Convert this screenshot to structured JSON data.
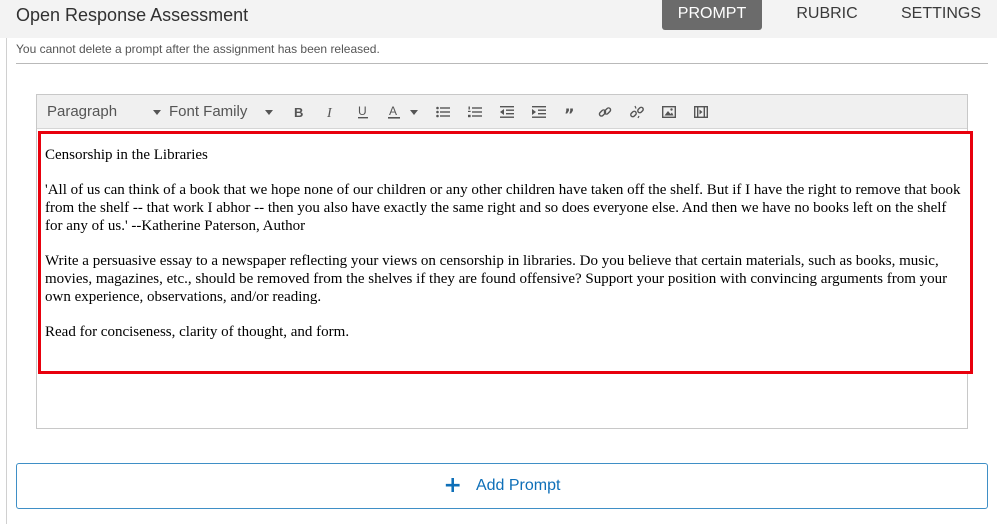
{
  "header": {
    "title": "Open Response Assessment",
    "tabs": [
      {
        "label": "PROMPT",
        "active": true
      },
      {
        "label": "RUBRIC",
        "active": false
      },
      {
        "label": "SETTINGS",
        "active": false
      }
    ]
  },
  "notice": "You cannot delete a prompt after the assignment has been released.",
  "toolbar": {
    "paragraph_label": "Paragraph",
    "font_family_label": "Font Family",
    "icons": [
      "bold-icon",
      "italic-icon",
      "underline-icon",
      "text-color-icon",
      "bullet-list-icon",
      "numbered-list-icon",
      "outdent-icon",
      "indent-icon",
      "blockquote-icon",
      "link-icon",
      "unlink-icon",
      "image-icon",
      "video-icon"
    ]
  },
  "prompt": {
    "title": "Censorship in the Libraries",
    "quote": "'All of us can think of a book that we hope none of our children or any other children have taken off the shelf. But if I have the right to remove that book from the shelf -- that work I abhor -- then you also have exactly the same right and so does everyone else. And then we have no books left on the shelf for any of us.' --Katherine Paterson, Author",
    "instructions": "Write a persuasive essay to a newspaper reflecting your views on censorship in libraries. Do you believe that certain materials, such as books, music, movies, magazines, etc., should be removed from the shelves if they are found offensive? Support your position with convincing arguments from your own experience, observations, and/or reading.",
    "criteria": "Read for conciseness, clarity of thought, and form."
  },
  "add_prompt": {
    "icon": "plus-icon",
    "plus": "+",
    "label": "Add Prompt"
  },
  "colors": {
    "accent": "#0e6fb8",
    "highlight": "#e8000d",
    "active_tab": "#6b6b6b"
  }
}
